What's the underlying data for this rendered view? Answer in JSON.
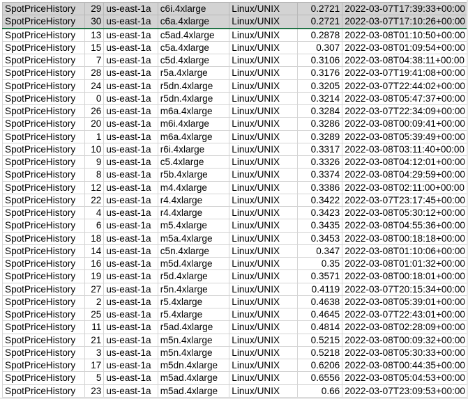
{
  "spreadsheet": {
    "rows": [
      [
        "SpotPriceHistory",
        "29",
        "us-east-1a",
        "c6i.4xlarge",
        "Linux/UNIX",
        "0.2721",
        "2022-03-07T17:39:33+00:00"
      ],
      [
        "SpotPriceHistory",
        "30",
        "us-east-1a",
        "c6a.4xlarge",
        "Linux/UNIX",
        "0.2721",
        "2022-03-07T17:10:26+00:00"
      ],
      [
        "SpotPriceHistory",
        "13",
        "us-east-1a",
        "c5ad.4xlarge",
        "Linux/UNIX",
        "0.2878",
        "2022-03-08T01:10:50+00:00"
      ],
      [
        "SpotPriceHistory",
        "15",
        "us-east-1a",
        "c5a.4xlarge",
        "Linux/UNIX",
        "0.307",
        "2022-03-08T01:09:54+00:00"
      ],
      [
        "SpotPriceHistory",
        "7",
        "us-east-1a",
        "c5d.4xlarge",
        "Linux/UNIX",
        "0.3106",
        "2022-03-08T04:38:11+00:00"
      ],
      [
        "SpotPriceHistory",
        "28",
        "us-east-1a",
        "r5a.4xlarge",
        "Linux/UNIX",
        "0.3176",
        "2022-03-07T19:41:08+00:00"
      ],
      [
        "SpotPriceHistory",
        "24",
        "us-east-1a",
        "r5dn.4xlarge",
        "Linux/UNIX",
        "0.3205",
        "2022-03-07T22:44:02+00:00"
      ],
      [
        "SpotPriceHistory",
        "0",
        "us-east-1a",
        "r5dn.4xlarge",
        "Linux/UNIX",
        "0.3214",
        "2022-03-08T05:47:37+00:00"
      ],
      [
        "SpotPriceHistory",
        "26",
        "us-east-1a",
        "m6a.4xlarge",
        "Linux/UNIX",
        "0.3284",
        "2022-03-07T22:34:09+00:00"
      ],
      [
        "SpotPriceHistory",
        "20",
        "us-east-1a",
        "m6i.4xlarge",
        "Linux/UNIX",
        "0.3286",
        "2022-03-08T00:09:41+00:00"
      ],
      [
        "SpotPriceHistory",
        "1",
        "us-east-1a",
        "m6a.4xlarge",
        "Linux/UNIX",
        "0.3289",
        "2022-03-08T05:39:49+00:00"
      ],
      [
        "SpotPriceHistory",
        "10",
        "us-east-1a",
        "r6i.4xlarge",
        "Linux/UNIX",
        "0.3317",
        "2022-03-08T03:11:40+00:00"
      ],
      [
        "SpotPriceHistory",
        "9",
        "us-east-1a",
        "c5.4xlarge",
        "Linux/UNIX",
        "0.3326",
        "2022-03-08T04:12:01+00:00"
      ],
      [
        "SpotPriceHistory",
        "8",
        "us-east-1a",
        "r5b.4xlarge",
        "Linux/UNIX",
        "0.3374",
        "2022-03-08T04:29:59+00:00"
      ],
      [
        "SpotPriceHistory",
        "12",
        "us-east-1a",
        "m4.4xlarge",
        "Linux/UNIX",
        "0.3386",
        "2022-03-08T02:11:00+00:00"
      ],
      [
        "SpotPriceHistory",
        "22",
        "us-east-1a",
        "r4.4xlarge",
        "Linux/UNIX",
        "0.3422",
        "2022-03-07T23:17:45+00:00"
      ],
      [
        "SpotPriceHistory",
        "4",
        "us-east-1a",
        "r4.4xlarge",
        "Linux/UNIX",
        "0.3423",
        "2022-03-08T05:30:12+00:00"
      ],
      [
        "SpotPriceHistory",
        "6",
        "us-east-1a",
        "m5.4xlarge",
        "Linux/UNIX",
        "0.3435",
        "2022-03-08T04:55:36+00:00"
      ],
      [
        "SpotPriceHistory",
        "18",
        "us-east-1a",
        "m5a.4xlarge",
        "Linux/UNIX",
        "0.3453",
        "2022-03-08T00:18:18+00:00"
      ],
      [
        "SpotPriceHistory",
        "14",
        "us-east-1a",
        "c5n.4xlarge",
        "Linux/UNIX",
        "0.347",
        "2022-03-08T01:10:06+00:00"
      ],
      [
        "SpotPriceHistory",
        "16",
        "us-east-1a",
        "m5d.4xlarge",
        "Linux/UNIX",
        "0.35",
        "2022-03-08T01:01:32+00:00"
      ],
      [
        "SpotPriceHistory",
        "19",
        "us-east-1a",
        "r5d.4xlarge",
        "Linux/UNIX",
        "0.3571",
        "2022-03-08T00:18:01+00:00"
      ],
      [
        "SpotPriceHistory",
        "27",
        "us-east-1a",
        "r5n.4xlarge",
        "Linux/UNIX",
        "0.4119",
        "2022-03-07T20:15:34+00:00"
      ],
      [
        "SpotPriceHistory",
        "2",
        "us-east-1a",
        "r5.4xlarge",
        "Linux/UNIX",
        "0.4638",
        "2022-03-08T05:39:01+00:00"
      ],
      [
        "SpotPriceHistory",
        "25",
        "us-east-1a",
        "r5.4xlarge",
        "Linux/UNIX",
        "0.4645",
        "2022-03-07T22:43:01+00:00"
      ],
      [
        "SpotPriceHistory",
        "11",
        "us-east-1a",
        "r5ad.4xlarge",
        "Linux/UNIX",
        "0.4814",
        "2022-03-08T02:28:09+00:00"
      ],
      [
        "SpotPriceHistory",
        "21",
        "us-east-1a",
        "m5n.4xlarge",
        "Linux/UNIX",
        "0.5215",
        "2022-03-08T00:09:32+00:00"
      ],
      [
        "SpotPriceHistory",
        "3",
        "us-east-1a",
        "m5n.4xlarge",
        "Linux/UNIX",
        "0.5218",
        "2022-03-08T05:30:33+00:00"
      ],
      [
        "SpotPriceHistory",
        "17",
        "us-east-1a",
        "m5dn.4xlarge",
        "Linux/UNIX",
        "0.6206",
        "2022-03-08T00:44:35+00:00"
      ],
      [
        "SpotPriceHistory",
        "5",
        "us-east-1a",
        "m5ad.4xlarge",
        "Linux/UNIX",
        "0.6556",
        "2022-03-08T05:04:53+00:00"
      ],
      [
        "SpotPriceHistory",
        "23",
        "us-east-1a",
        "m5ad.4xlarge",
        "Linux/UNIX",
        "0.66",
        "2022-03-07T23:09:53+00:00"
      ]
    ],
    "selected_rows": [
      0,
      1
    ],
    "colors": {
      "selection_fill": "#d3d3d3",
      "selection_border": "#217346",
      "gridline": "#d4d4d4"
    }
  }
}
